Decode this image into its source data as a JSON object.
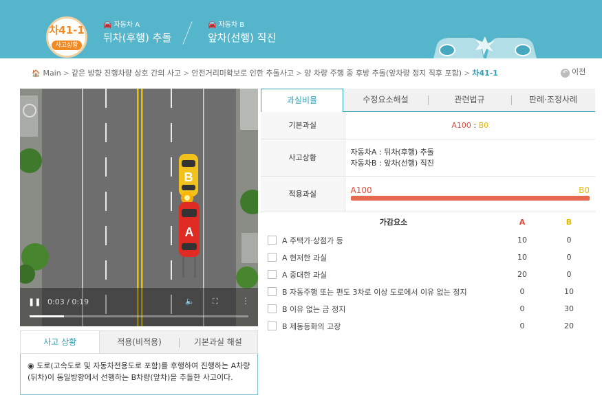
{
  "header": {
    "code": "차41-1",
    "code_label": "사고상황",
    "car_a": {
      "icon": "car-icon",
      "who": "자동차 A",
      "desc": "뒤차(후행) 추돌"
    },
    "car_b": {
      "icon": "car-icon",
      "who": "자동차 B",
      "desc": "앞차(선행) 직진"
    },
    "colors": {
      "banner": "#55b6cb",
      "badge_accent": "#f08a24"
    }
  },
  "breadcrumb": {
    "items": [
      "Main",
      "같은 방향 진행차량 상호 간의 사고",
      "안전거리미확보로 인한 추돌사고",
      "양 차량 주행 중 후방 추돌(앞차량 정지 직후 포함)"
    ],
    "current": "차41-1",
    "separator": ">",
    "prev_label": "이전"
  },
  "video": {
    "time": "0:03 / 0:19",
    "progress": 0.158,
    "car_a_letter": "A",
    "car_b_letter": "B"
  },
  "lower_tabs": [
    "사고 상황",
    "적용(비적용)",
    "기본과실 해설"
  ],
  "situation_text": "◉ 도로(고속도로 및 자동차전용도로 포함)를 후행하여 진행하는 A차량(뒤차)이 동일방향에서 선행하는 B차량(앞차)을 추돌한 사고이다.",
  "right_tabs": [
    "과실비율",
    "수정요소해설",
    "관련법규",
    "판례·조정사례"
  ],
  "fault": {
    "basic_label": "기본과실",
    "basic_a": "A100",
    "basic_sep": " : ",
    "basic_b": "B0",
    "situation_label": "사고상황",
    "situation_lines": [
      "자동차A : 뒤차(후행) 추돌",
      "자동차B : 앞차(선행) 직진"
    ],
    "applied_label": "적용과실",
    "applied_a": "A100",
    "applied_b": "B0",
    "applied_a_ratio": 1.0
  },
  "factors": {
    "header": {
      "name": "가감요소",
      "a": "A",
      "b": "B"
    },
    "rows": [
      {
        "name": "A 주택가·상점가 등",
        "a": "10",
        "b": "0"
      },
      {
        "name": "A 현저한 과실",
        "a": "10",
        "b": "0"
      },
      {
        "name": "A 중대한 과실",
        "a": "20",
        "b": "0"
      },
      {
        "name": "B 자동주행 또는 편도 3차로 이상 도로에서 이유 없는 정지",
        "a": "0",
        "b": "10"
      },
      {
        "name": "B 이유 없는 급 정지",
        "a": "0",
        "b": "30"
      },
      {
        "name": "B 제동등화의 고장",
        "a": "0",
        "b": "20"
      }
    ]
  },
  "colors": {
    "accent": "#2f9fb6",
    "a_color": "#e14b3b",
    "b_color": "#e6b800",
    "bar": "#e66a52"
  }
}
